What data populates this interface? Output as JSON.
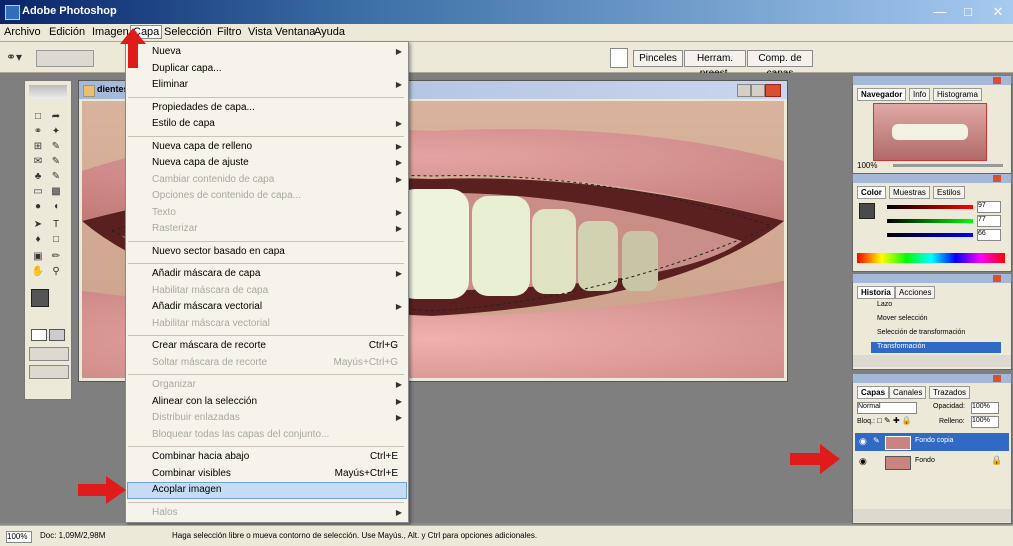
{
  "window": {
    "title": "Adobe Photoshop"
  },
  "menubar": {
    "items": [
      "Archivo",
      "Edición",
      "Imagen",
      "Capa",
      "Selección",
      "Filtro",
      "Vista",
      "Ventana",
      "Ayuda"
    ]
  },
  "optbar": {
    "wells": [
      "Pinceles",
      "Herram. preest.",
      "Comp. de capas"
    ]
  },
  "document": {
    "title": "dientes.t"
  },
  "menu": {
    "items": [
      {
        "label": "Nueva",
        "shortcut": "",
        "disabled": false,
        "submenu": true
      },
      {
        "label": "Duplicar capa...",
        "shortcut": "",
        "disabled": false,
        "submenu": false
      },
      {
        "label": "Eliminar",
        "shortcut": "",
        "disabled": false,
        "submenu": true
      },
      {
        "label": "Propiedades de capa...",
        "shortcut": "",
        "disabled": false,
        "submenu": false
      },
      {
        "label": "Estilo de capa",
        "shortcut": "",
        "disabled": false,
        "submenu": true
      },
      {
        "label": "Nueva capa de relleno",
        "shortcut": "",
        "disabled": false,
        "submenu": true
      },
      {
        "label": "Nueva capa de ajuste",
        "shortcut": "",
        "disabled": false,
        "submenu": true
      },
      {
        "label": "Cambiar contenido de capa",
        "shortcut": "",
        "disabled": true,
        "submenu": true
      },
      {
        "label": "Opciones de contenido de capa...",
        "shortcut": "",
        "disabled": true,
        "submenu": false
      },
      {
        "label": "Texto",
        "shortcut": "",
        "disabled": true,
        "submenu": true
      },
      {
        "label": "Rasterizar",
        "shortcut": "",
        "disabled": true,
        "submenu": true
      },
      {
        "label": "Nuevo sector basado en capa",
        "shortcut": "",
        "disabled": false,
        "submenu": false
      },
      {
        "label": "Añadir máscara de capa",
        "shortcut": "",
        "disabled": false,
        "submenu": true
      },
      {
        "label": "Habilitar máscara de capa",
        "shortcut": "",
        "disabled": true,
        "submenu": false
      },
      {
        "label": "Añadir máscara vectorial",
        "shortcut": "",
        "disabled": false,
        "submenu": true
      },
      {
        "label": "Habilitar máscara vectorial",
        "shortcut": "",
        "disabled": true,
        "submenu": false
      },
      {
        "label": "Crear máscara de recorte",
        "shortcut": "Ctrl+G",
        "disabled": false,
        "submenu": false
      },
      {
        "label": "Soltar máscara de recorte",
        "shortcut": "Mayús+Ctrl+G",
        "disabled": true,
        "submenu": false
      },
      {
        "label": "Organizar",
        "shortcut": "",
        "disabled": true,
        "submenu": true
      },
      {
        "label": "Alinear con la selección",
        "shortcut": "",
        "disabled": false,
        "submenu": true
      },
      {
        "label": "Distribuir enlazadas",
        "shortcut": "",
        "disabled": true,
        "submenu": true
      },
      {
        "label": "Bloquear todas las capas del conjunto...",
        "shortcut": "",
        "disabled": true,
        "submenu": false
      },
      {
        "label": "Combinar hacia abajo",
        "shortcut": "Ctrl+E",
        "disabled": false,
        "submenu": false
      },
      {
        "label": "Combinar visibles",
        "shortcut": "Mayús+Ctrl+E",
        "disabled": false,
        "submenu": false
      },
      {
        "label": "Acoplar imagen",
        "shortcut": "",
        "disabled": false,
        "submenu": false
      },
      {
        "label": "Halos",
        "shortcut": "",
        "disabled": true,
        "submenu": true
      }
    ]
  },
  "navigator": {
    "tabs": [
      "Navegador",
      "Info",
      "Histograma"
    ],
    "zoom": "100%"
  },
  "color": {
    "tabs": [
      "Color",
      "Muestras",
      "Estilos"
    ],
    "r": "97",
    "g": "77",
    "b": "66",
    "accent": "#4a4a4a"
  },
  "history": {
    "tabs": [
      "Historia",
      "Acciones"
    ],
    "items": [
      "Lazo",
      "Mover selección",
      "Selección de transformación",
      "Transformación"
    ]
  },
  "layers": {
    "tabs": [
      "Capas",
      "Canales",
      "Trazados"
    ],
    "mode": "Normal",
    "opacity_label": "Opacidad:",
    "opacity": "100%",
    "lock_label": "Bloq.:",
    "fill_label": "Relleno:",
    "fill": "100%",
    "rows": [
      "Fondo copia",
      "Fondo"
    ]
  },
  "status": {
    "zoom": "100%",
    "doc": "Doc: 1,09M/2,98M",
    "hint": "Haga selección libre o mueva contorno de selección. Use Mayús., Alt. y Ctrl para opciones adicionales."
  }
}
